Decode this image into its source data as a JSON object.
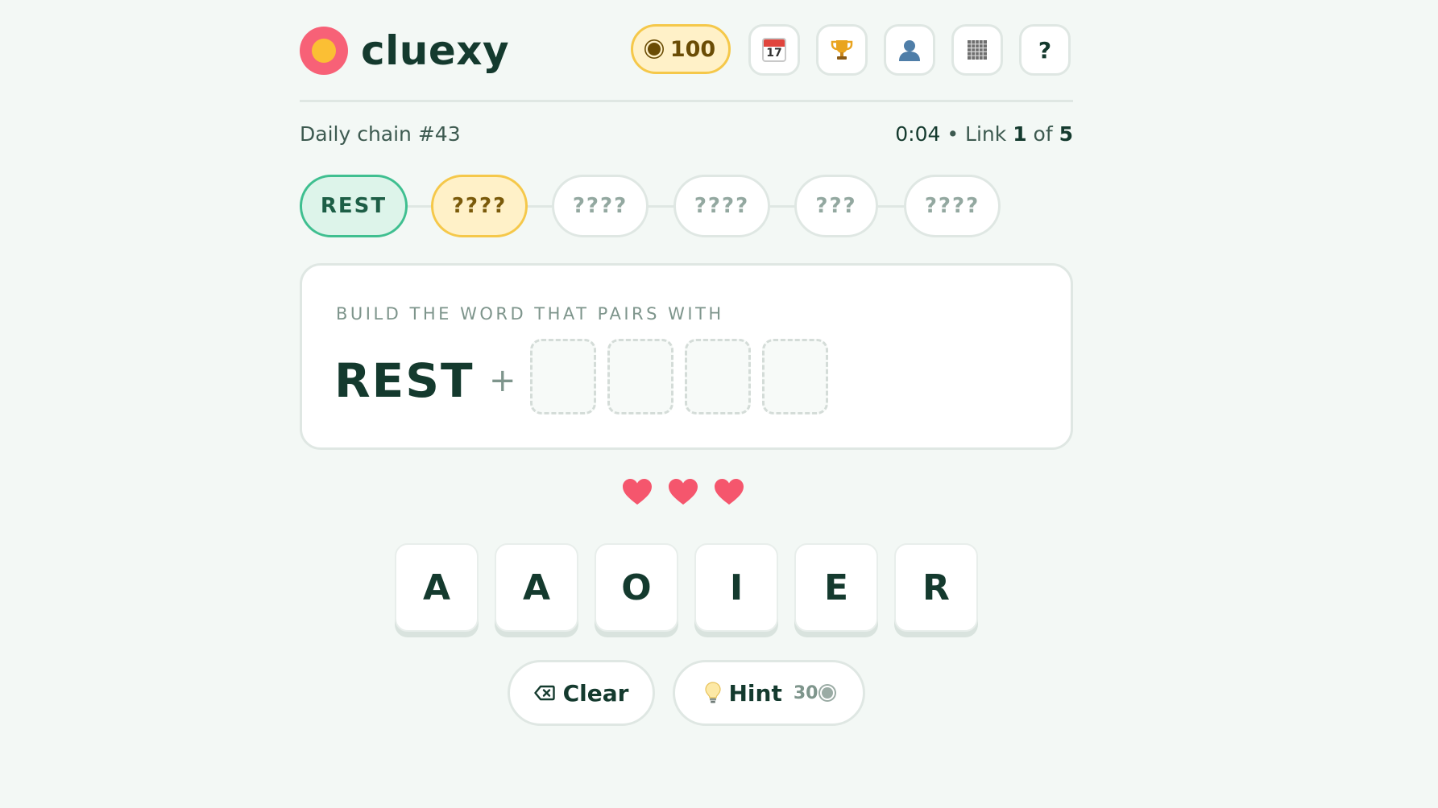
{
  "app": {
    "brand": "cluexy",
    "coins": "100",
    "help_label": "?",
    "calendar_day": "17"
  },
  "status": {
    "chain_label": "Daily chain #43",
    "timer": "0:04",
    "separator": " • ",
    "link_word": "Link ",
    "link_current": "1",
    "of_word": " of ",
    "link_total": "5"
  },
  "chain": {
    "pills": [
      {
        "label": "REST",
        "state": "done"
      },
      {
        "label": "????",
        "state": "active"
      },
      {
        "label": "????",
        "state": "locked"
      },
      {
        "label": "????",
        "state": "locked"
      },
      {
        "label": "???",
        "state": "locked"
      },
      {
        "label": "????",
        "state": "locked"
      }
    ]
  },
  "card": {
    "prompt": "BUILD THE WORD THAT PAIRS WITH",
    "word": "REST",
    "plus": "+",
    "slot_count": 4
  },
  "lives": {
    "hearts": 3,
    "color": "#f5566d"
  },
  "tiles": [
    "A",
    "A",
    "O",
    "I",
    "E",
    "R"
  ],
  "actions": {
    "clear_label": "Clear",
    "hint_label": "Hint",
    "hint_cost": "30"
  },
  "colors": {
    "accent_green": "#3fbf90",
    "accent_yellow": "#f5c84a",
    "logo_pink": "#f76177",
    "logo_yellow": "#fbbf34",
    "text_dark": "#143a2e"
  },
  "icons": {
    "calendar": "calendar-icon",
    "trophy": "trophy-icon",
    "profile": "user-icon",
    "stats": "grid-icon",
    "help": "help-icon",
    "clear": "backspace-icon",
    "hint": "lightbulb-icon",
    "coin": "coin-icon",
    "heart": "heart-icon"
  }
}
